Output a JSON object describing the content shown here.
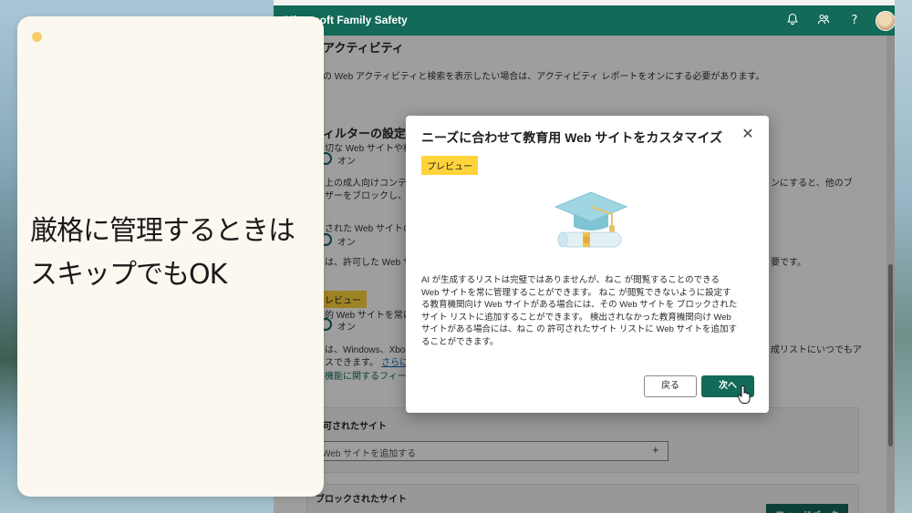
{
  "app": {
    "title": "Microsoft Family Safety"
  },
  "header_icons": [
    "bell-icon",
    "family-icon",
    "help-icon",
    "avatar"
  ],
  "background_page": {
    "activity_heading": "アクティビティ",
    "activity_text": "の Web アクティビティと検索を表示したい場合は、アクティビティ レポートをオンにする必要があります。",
    "filter_heading": "ィルターの設定",
    "filter_item1_text": "切な Web サイトや検",
    "toggle_on": "オン",
    "filter_item1_desc_a": "上の成人向けコンテ",
    "filter_item1_desc_a_right": "ンにすると、他のブ",
    "filter_item1_desc_b": "ザーをブロックし、",
    "allowed_only_text": "された Web サイトの",
    "allowed_only_desc": "は、許可した Web サ",
    "allowed_only_desc_right": "要です。",
    "preview_badge": "レビュー",
    "edu_sites_text": "的 Web サイトを常に",
    "edu_desc_a": "は、Windows、Xbox",
    "edu_desc_a_right": "成リストにいつでもア",
    "edu_desc_b": "スできます。",
    "edu_link": "さらに",
    "feedback_text": "機能に関するフィー",
    "allowed_sites_heading": "可されたサイト",
    "add_site_placeholder": "Web サイトを追加する",
    "blocked_sites_heading": "ブロックされたサイト",
    "feedback_button": "フィードバック"
  },
  "dialog": {
    "title": "ニーズに合わせて教育用 Web サイトをカスタマイズ",
    "preview_badge": "プレビュー",
    "body_lines": [
      "AI が生成するリストは完璧ではありませんが、ねこ が閲覧することのできる",
      "Web サイトを常に管理することができます。 ねこ が閲覧できないように設定す",
      "る教育機関向け Web サイトがある場合には、その Web サイトを ブロックされた",
      "サイト リストに追加することができます。 検出されなかった教育機関向け Web",
      "サイトがある場合には、ねこ の 許可されたサイト リストに Web サイトを追加す",
      "ることができます。"
    ],
    "back_button": "戻る",
    "next_button": "次へ",
    "illustration": "graduation-cap-diploma-illustration"
  },
  "note_card": {
    "line1": "厳格に管理するときは",
    "line2": "スキップでもOK"
  },
  "colors": {
    "brand_green": "#136a58",
    "badge_yellow": "#ffd43b",
    "note_bg": "#fdf8ef"
  }
}
